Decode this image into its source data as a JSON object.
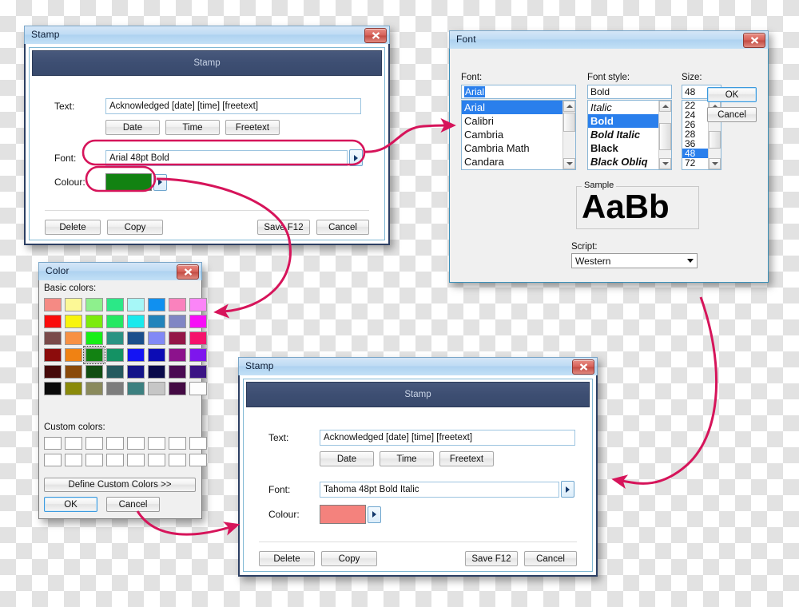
{
  "background": {
    "type": "transparency-checkerboard",
    "light": "#ffffff",
    "dark": "#e2e2e2"
  },
  "accent": {
    "highlight_blue": "#2a7fec",
    "annotation_pink": "#d6145a",
    "title_blue": "#bfdcf4",
    "band_navy": "#3d4e72"
  },
  "stamp_before": {
    "window_title": "Stamp",
    "band_title": "Stamp",
    "close_label": "x",
    "fields": {
      "text_label": "Text:",
      "text_value": "Acknowledged [date] [time] [freetext]",
      "font_label": "Font:",
      "font_value": "Arial 48pt Bold",
      "colour_label": "Colour:",
      "colour_value": "#128212"
    },
    "insert_buttons": [
      "Date",
      "Time",
      "Freetext"
    ],
    "footer_left": [
      "Delete",
      "Copy"
    ],
    "footer_right": [
      "Save F12",
      "Cancel"
    ]
  },
  "stamp_after": {
    "window_title": "Stamp",
    "band_title": "Stamp",
    "close_label": "x",
    "fields": {
      "text_label": "Text:",
      "text_value": "Acknowledged [date] [time] [freetext]",
      "font_label": "Font:",
      "font_value": "Tahoma 48pt Bold Italic",
      "colour_label": "Colour:",
      "colour_value": "#f4827d"
    },
    "insert_buttons": [
      "Date",
      "Time",
      "Freetext"
    ],
    "footer_left": [
      "Delete",
      "Copy"
    ],
    "footer_right": [
      "Save F12",
      "Cancel"
    ]
  },
  "font_dialog": {
    "window_title": "Font",
    "close_label": "x",
    "font_label": "Font:",
    "font_input": "Arial",
    "font_list": [
      "Arial",
      "Calibri",
      "Cambria",
      "Cambria Math",
      "Candara"
    ],
    "font_selected": "Arial",
    "style_label": "Font style:",
    "style_input": "Bold",
    "style_list": [
      "Italic",
      "Bold",
      "Bold Italic",
      "Black",
      "Black Obliq"
    ],
    "style_selected": "Bold",
    "size_label": "Size:",
    "size_input": "48",
    "size_list": [
      "22",
      "24",
      "26",
      "28",
      "36",
      "48",
      "72"
    ],
    "size_selected": "48",
    "ok_label": "OK",
    "cancel_label": "Cancel",
    "sample_label": "Sample",
    "sample_text": "AaBb",
    "script_label": "Script:",
    "script_value": "Western"
  },
  "color_dialog": {
    "window_title": "Color",
    "close_label": "x",
    "basic_colors_label": "Basic colors:",
    "custom_colors_label": "Custom colors:",
    "define_label": "Define Custom Colors >>",
    "ok_label": "OK",
    "cancel_label": "Cancel",
    "selected_index": 26,
    "basic_colors": [
      "#f58a84",
      "#fcf896",
      "#8ef08d",
      "#2be887",
      "#a6f7f7",
      "#1090f0",
      "#fa82bd",
      "#fb85f7",
      "#fa0b0b",
      "#f8f40c",
      "#7ceb0c",
      "#24e862",
      "#1ae9ec",
      "#2284bb",
      "#8086c4",
      "#f70df6",
      "#7a4a4a",
      "#f79144",
      "#17ef17",
      "#2a9383",
      "#1b4f8c",
      "#8189f6",
      "#941648",
      "#f5136c",
      "#8c0c0c",
      "#f08213",
      "#128212",
      "#149264",
      "#1414f4",
      "#0c0cb5",
      "#8c128c",
      "#7e16ed",
      "#460a0a",
      "#8a4a0a",
      "#114d11",
      "#255a5f",
      "#141489",
      "#0a0a4a",
      "#4a0a52",
      "#3b1484",
      "#0a0a0a",
      "#8a8a0a",
      "#8a8a5c",
      "#7d7d7d",
      "#3c8080",
      "#c6c6c6",
      "#440a44",
      "#fdfdfd"
    ]
  },
  "annotations": {
    "arrow_color": "#d6145a",
    "callout_color": "#d6145a",
    "arrows": [
      {
        "name": "font-field-to-font-dialog"
      },
      {
        "name": "colour-field-to-color-dialog"
      },
      {
        "name": "color-dialog-to-stamp-after"
      },
      {
        "name": "font-dialog-to-stamp-after"
      }
    ],
    "callouts": [
      {
        "name": "font-field-highlight"
      },
      {
        "name": "colour-field-highlight"
      }
    ]
  }
}
